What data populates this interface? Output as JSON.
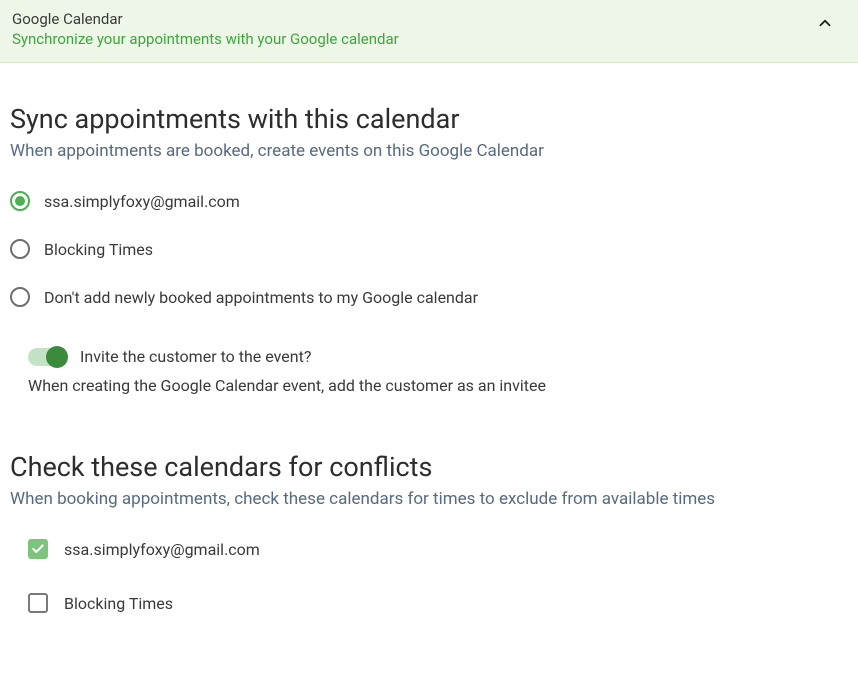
{
  "header": {
    "title": "Google Calendar",
    "subtitle": "Synchronize your appointments with your Google calendar"
  },
  "sync": {
    "heading": "Sync appointments with this calendar",
    "sub": "When appointments are booked, create events on this Google Calendar",
    "options": [
      {
        "label": "ssa.simplyfoxy@gmail.com",
        "selected": true
      },
      {
        "label": "Blocking Times",
        "selected": false
      },
      {
        "label": "Don't add newly booked appointments to my Google calendar",
        "selected": false
      }
    ]
  },
  "invite": {
    "toggle_on": true,
    "label": "Invite the customer to the event?",
    "desc": "When creating the Google Calendar event, add the customer as an invitee"
  },
  "conflicts": {
    "heading": "Check these calendars for conflicts",
    "sub": "When booking appointments, check these calendars for times to exclude from available times",
    "options": [
      {
        "label": "ssa.simplyfoxy@gmail.com",
        "checked": true
      },
      {
        "label": "Blocking Times",
        "checked": false
      }
    ]
  }
}
